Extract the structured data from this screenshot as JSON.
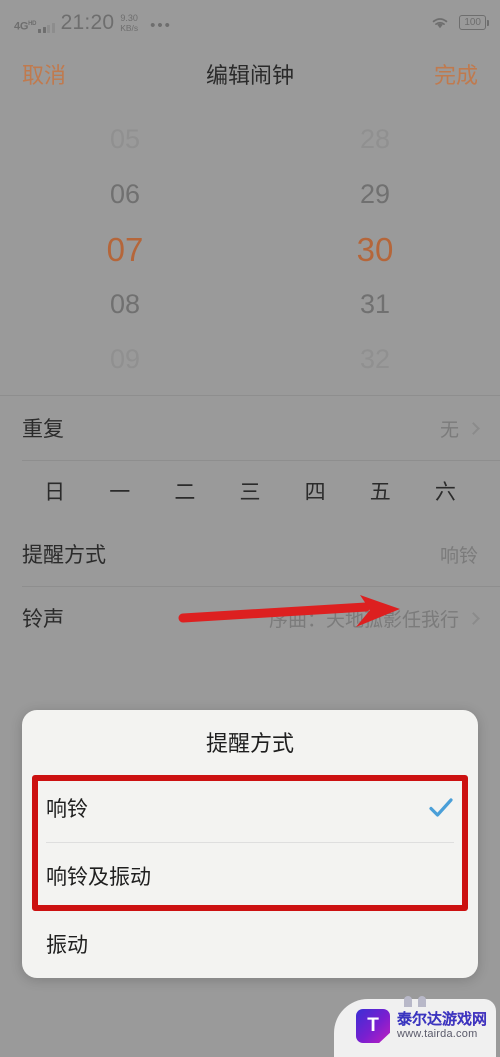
{
  "statusbar": {
    "network_type": "4G",
    "network_suffix": "HD",
    "time": "21:20",
    "netspeed_value": "9.30",
    "netspeed_unit": "KB/s",
    "overflow": "•••",
    "wifi_icon": "wifi-icon",
    "battery": "100"
  },
  "navbar": {
    "cancel_label": "取消",
    "title": "编辑闹钟",
    "done_label": "完成",
    "accent_color": "#c07a4e"
  },
  "time_picker": {
    "hours": [
      "05",
      "06",
      "07",
      "08",
      "09"
    ],
    "minutes": [
      "28",
      "29",
      "30",
      "31",
      "32"
    ],
    "selected_hour": "07",
    "selected_minute": "30",
    "selected_color": "#b5663a"
  },
  "rows": {
    "repeat": {
      "label": "重复",
      "value": "无"
    },
    "weekdays": [
      "日",
      "一",
      "二",
      "三",
      "四",
      "五",
      "六"
    ],
    "reminder": {
      "label": "提醒方式",
      "value": "响铃"
    },
    "ringtone": {
      "label": "铃声",
      "value": "序曲：天地孤影任我行"
    }
  },
  "annotation": {
    "arrow_color": "#dd2020",
    "highlight_color": "#cc1111"
  },
  "dialog": {
    "title": "提醒方式",
    "options": [
      {
        "label": "响铃",
        "checked": true
      },
      {
        "label": "响铃及振动",
        "checked": false
      },
      {
        "label": "振动",
        "checked": false
      }
    ],
    "check_color": "#4a9fd8"
  },
  "watermark": {
    "logo_letter": "T",
    "site_name": "泰尔达游戏网",
    "url": "www.tairda.com"
  }
}
